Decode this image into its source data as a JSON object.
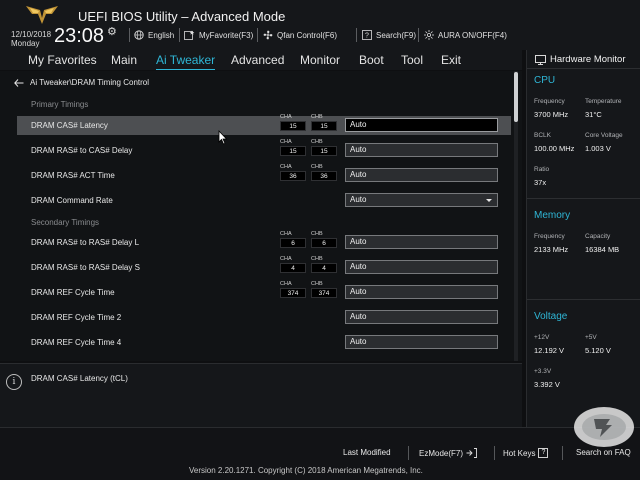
{
  "header": {
    "title": "UEFI BIOS Utility – Advanced Mode",
    "date": "12/10/2018",
    "day": "Monday",
    "time": "23:08",
    "items": {
      "language": "English",
      "favorite": "MyFavorite(F3)",
      "qfan": "Qfan Control(F6)",
      "search": "Search(F9)",
      "aura": "AURA ON/OFF(F4)"
    }
  },
  "tabs": [
    "My Favorites",
    "Main",
    "Ai Tweaker",
    "Advanced",
    "Monitor",
    "Boot",
    "Tool",
    "Exit"
  ],
  "active_tab": "Ai Tweaker",
  "breadcrumb": "Ai Tweaker\\DRAM Timing Control",
  "sections": {
    "primary": "Primary Timings",
    "secondary": "Secondary Timings"
  },
  "rows": [
    {
      "label": "DRAM CAS# Latency",
      "cha": "15",
      "chb": "15",
      "value": "Auto",
      "dropdown": false
    },
    {
      "label": "DRAM RAS# to CAS# Delay",
      "cha": "15",
      "chb": "15",
      "value": "Auto",
      "dropdown": false
    },
    {
      "label": "DRAM RAS# ACT Time",
      "cha": "36",
      "chb": "36",
      "value": "Auto",
      "dropdown": false
    },
    {
      "label": "DRAM Command Rate",
      "cha": "",
      "chb": "",
      "value": "Auto",
      "dropdown": true
    },
    {
      "label": "DRAM RAS# to RAS# Delay L",
      "cha": "6",
      "chb": "6",
      "value": "Auto",
      "dropdown": false
    },
    {
      "label": "DRAM RAS# to RAS# Delay S",
      "cha": "4",
      "chb": "4",
      "value": "Auto",
      "dropdown": false
    },
    {
      "label": "DRAM REF Cycle Time",
      "cha": "374",
      "chb": "374",
      "value": "Auto",
      "dropdown": false
    },
    {
      "label": "DRAM REF Cycle Time 2",
      "cha": "",
      "chb": "",
      "value": "Auto",
      "dropdown": false
    },
    {
      "label": "DRAM REF Cycle Time 4",
      "cha": "",
      "chb": "",
      "value": "Auto",
      "dropdown": false
    }
  ],
  "channel_labels": {
    "a": "CHA",
    "b": "CHB"
  },
  "help_text": "DRAM CAS# Latency (tCL)",
  "hw_monitor": {
    "title": "Hardware Monitor",
    "cpu": {
      "heading": "CPU",
      "frequency_label": "Frequency",
      "frequency": "3700 MHz",
      "temperature_label": "Temperature",
      "temperature": "31°C",
      "bclk_label": "BCLK",
      "bclk": "100.00 MHz",
      "core_voltage_label": "Core Voltage",
      "core_voltage": "1.003 V",
      "ratio_label": "Ratio",
      "ratio": "37x"
    },
    "memory": {
      "heading": "Memory",
      "frequency_label": "Frequency",
      "frequency": "2133 MHz",
      "capacity_label": "Capacity",
      "capacity": "16384 MB"
    },
    "voltage": {
      "heading": "Voltage",
      "v12_label": "+12V",
      "v12": "12.192 V",
      "v5_label": "+5V",
      "v5": "5.120 V",
      "v33_label": "+3.3V",
      "v33": "3.392 V"
    }
  },
  "footer": {
    "last_modified": "Last Modified",
    "ezmode": "EzMode(F7)",
    "hotkeys": "Hot Keys",
    "hotkeys_key": "?",
    "search_faq": "Search on FAQ",
    "version": "Version 2.20.1271. Copyright (C) 2018 American Megatrends, Inc."
  },
  "colors": {
    "accent": "#2fb6d6",
    "background": "#0e0f11"
  }
}
